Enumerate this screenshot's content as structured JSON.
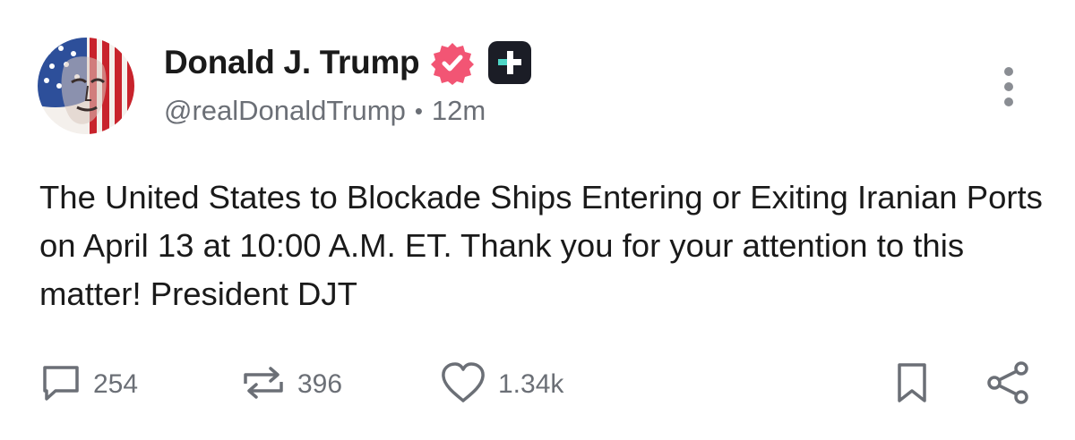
{
  "author": {
    "display_name": "Donald J. Trump",
    "handle": "@realDonaldTrump",
    "time_ago": "12m",
    "separator": "•",
    "verified_color": "#f25574",
    "plus_badge_color": "#1b1d26"
  },
  "post": {
    "text": "The United States to Blockade Ships Entering or Exiting Iranian Ports on April 13 at 10:00 A.M. ET. Thank you for your attention to this matter! President DJT"
  },
  "actions": {
    "replies": "254",
    "reposts": "396",
    "likes": "1.34k"
  },
  "icons": {
    "reply": "reply-icon",
    "repost": "repost-icon",
    "like": "heart-icon",
    "bookmark": "bookmark-icon",
    "share": "share-icon",
    "more": "more-vertical-icon",
    "verified": "verified-badge-icon",
    "plus": "plus-badge-icon"
  }
}
